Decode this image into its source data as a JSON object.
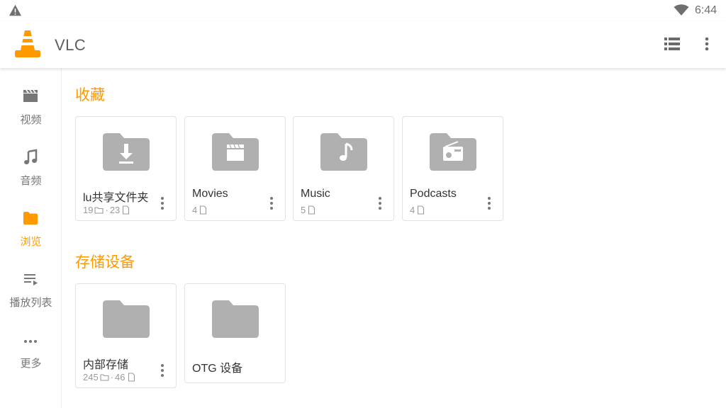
{
  "status_bar": {
    "time": "6:44",
    "warning_icon": "warning-icon",
    "wifi_icon": "wifi-icon"
  },
  "app_bar": {
    "title": "VLC",
    "logo_icon": "vlc-cone-icon",
    "list_toggle_icon": "list-view-icon",
    "overflow_icon": "more-vertical-icon"
  },
  "colors": {
    "accent": "#ff9900",
    "folder_gray": "#b0b0b0",
    "text_gray": "#777777"
  },
  "sidebar": {
    "items": [
      {
        "label": "视频",
        "icon": "video-icon",
        "active": false
      },
      {
        "label": "音频",
        "icon": "music-note-icon",
        "active": false
      },
      {
        "label": "浏览",
        "icon": "folder-icon",
        "active": true
      },
      {
        "label": "播放列表",
        "icon": "playlist-icon",
        "active": false
      },
      {
        "label": "更多",
        "icon": "more-horizontal-icon",
        "active": false
      }
    ]
  },
  "favorites": {
    "title": "收藏",
    "cards": [
      {
        "name": "lu共享文件夹",
        "icon": "folder-download-icon",
        "folders": "19",
        "separator": "·",
        "files": "23"
      },
      {
        "name": "Movies",
        "icon": "folder-movie-icon",
        "files": "4"
      },
      {
        "name": "Music",
        "icon": "folder-music-icon",
        "files": "5"
      },
      {
        "name": "Podcasts",
        "icon": "folder-radio-icon",
        "files": "4"
      }
    ]
  },
  "storage": {
    "title": "存储设备",
    "cards": [
      {
        "name": "内部存储",
        "icon": "folder-icon",
        "folders": "245",
        "separator": "·",
        "files": "46"
      },
      {
        "name": "OTG 设备",
        "icon": "folder-icon"
      }
    ]
  }
}
